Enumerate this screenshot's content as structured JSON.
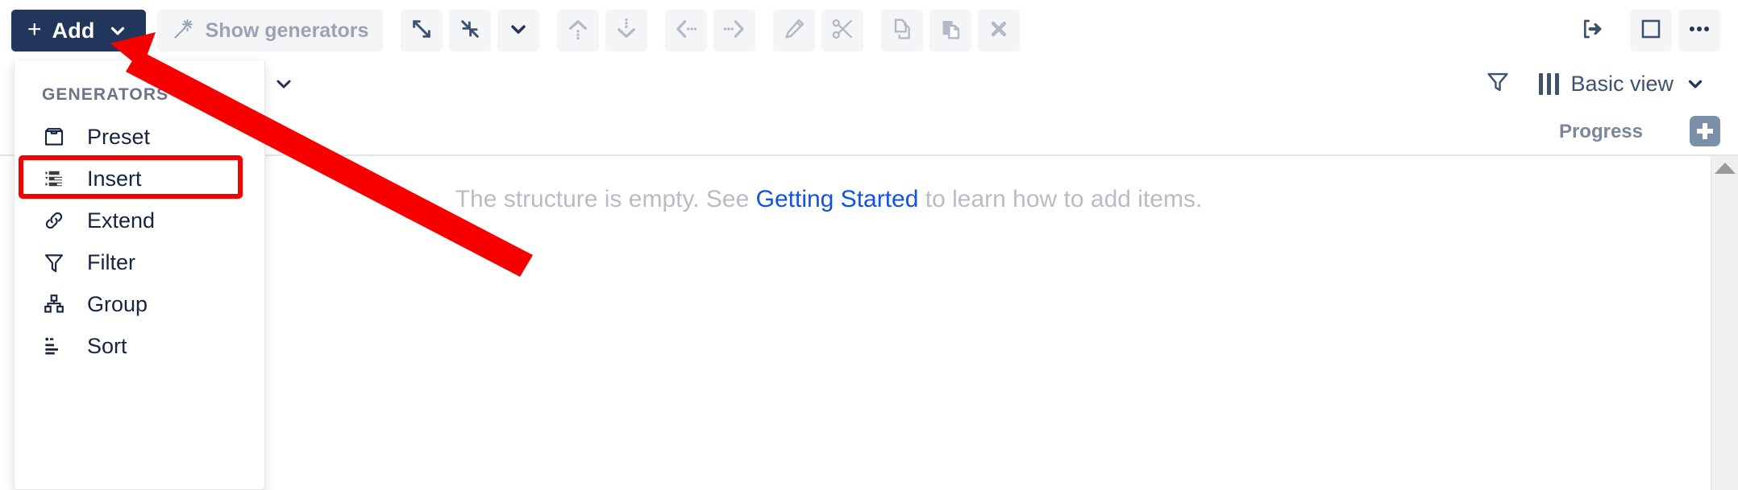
{
  "toolbar": {
    "add_button": {
      "plus": "+",
      "label": "Add",
      "chevron": "chevron-down"
    },
    "show_generators": {
      "label": "Show generators",
      "icon": "magic-wand-icon"
    },
    "buttons": [
      {
        "name": "expand-all-button",
        "icon": "expand-arrows-icon",
        "enabled": true
      },
      {
        "name": "collapse-all-button",
        "icon": "collapse-arrows-icon",
        "enabled": true
      },
      {
        "name": "expand-options-button",
        "icon": "chevron-down-icon",
        "enabled": true
      },
      {
        "name": "move-up-button",
        "icon": "arrow-up-dotted-icon",
        "enabled": false
      },
      {
        "name": "move-down-button",
        "icon": "arrow-down-dotted-icon",
        "enabled": false
      },
      {
        "name": "outdent-button",
        "icon": "arrow-left-dotted-icon",
        "enabled": false
      },
      {
        "name": "indent-button",
        "icon": "arrow-right-dotted-icon",
        "enabled": false
      },
      {
        "name": "edit-button",
        "icon": "pencil-icon",
        "enabled": false
      },
      {
        "name": "cut-button",
        "icon": "scissors-icon",
        "enabled": false
      },
      {
        "name": "copy-button",
        "icon": "copy-pages-icon",
        "enabled": false
      },
      {
        "name": "paste-button",
        "icon": "clipboard-paste-icon",
        "enabled": false
      },
      {
        "name": "delete-button",
        "icon": "close-x-icon",
        "enabled": false
      }
    ],
    "right_buttons": [
      {
        "name": "export-button",
        "icon": "export-arrow-icon"
      },
      {
        "name": "fullscreen-button",
        "icon": "square-outline-icon"
      },
      {
        "name": "more-options-button",
        "icon": "ellipsis-icon"
      }
    ]
  },
  "menu": {
    "section_label": "GENERATORS",
    "section_icon": "magic-wand-icon",
    "items": [
      {
        "label": "Preset",
        "icon": "preset-box-icon",
        "highlighted": false
      },
      {
        "label": "Insert",
        "icon": "insert-list-icon",
        "highlighted": true
      },
      {
        "label": "Extend",
        "icon": "link-chain-icon",
        "highlighted": false
      },
      {
        "label": "Filter",
        "icon": "funnel-icon",
        "highlighted": false
      },
      {
        "label": "Group",
        "icon": "group-squares-icon",
        "highlighted": false
      },
      {
        "label": "Sort",
        "icon": "sort-bars-icon",
        "highlighted": false
      }
    ]
  },
  "view_bar": {
    "filter_icon": "funnel-icon",
    "columns_icon": "columns-icon",
    "view_name": "Basic view",
    "chevron": "chevron-down-icon"
  },
  "table": {
    "columns": [
      {
        "label": "Progress"
      }
    ],
    "add_column_icon": "plus-square-icon",
    "empty_message_prefix": "The structure is empty. See ",
    "empty_message_link": "Getting Started",
    "empty_message_suffix": " to learn how to add items."
  },
  "colors": {
    "brand_dark": "#22355b",
    "accent_link": "#1053e6",
    "annotation_red": "#f90000",
    "toolbar_button_bg": "#f4f5f7",
    "muted_text": "#9aa3b2"
  }
}
